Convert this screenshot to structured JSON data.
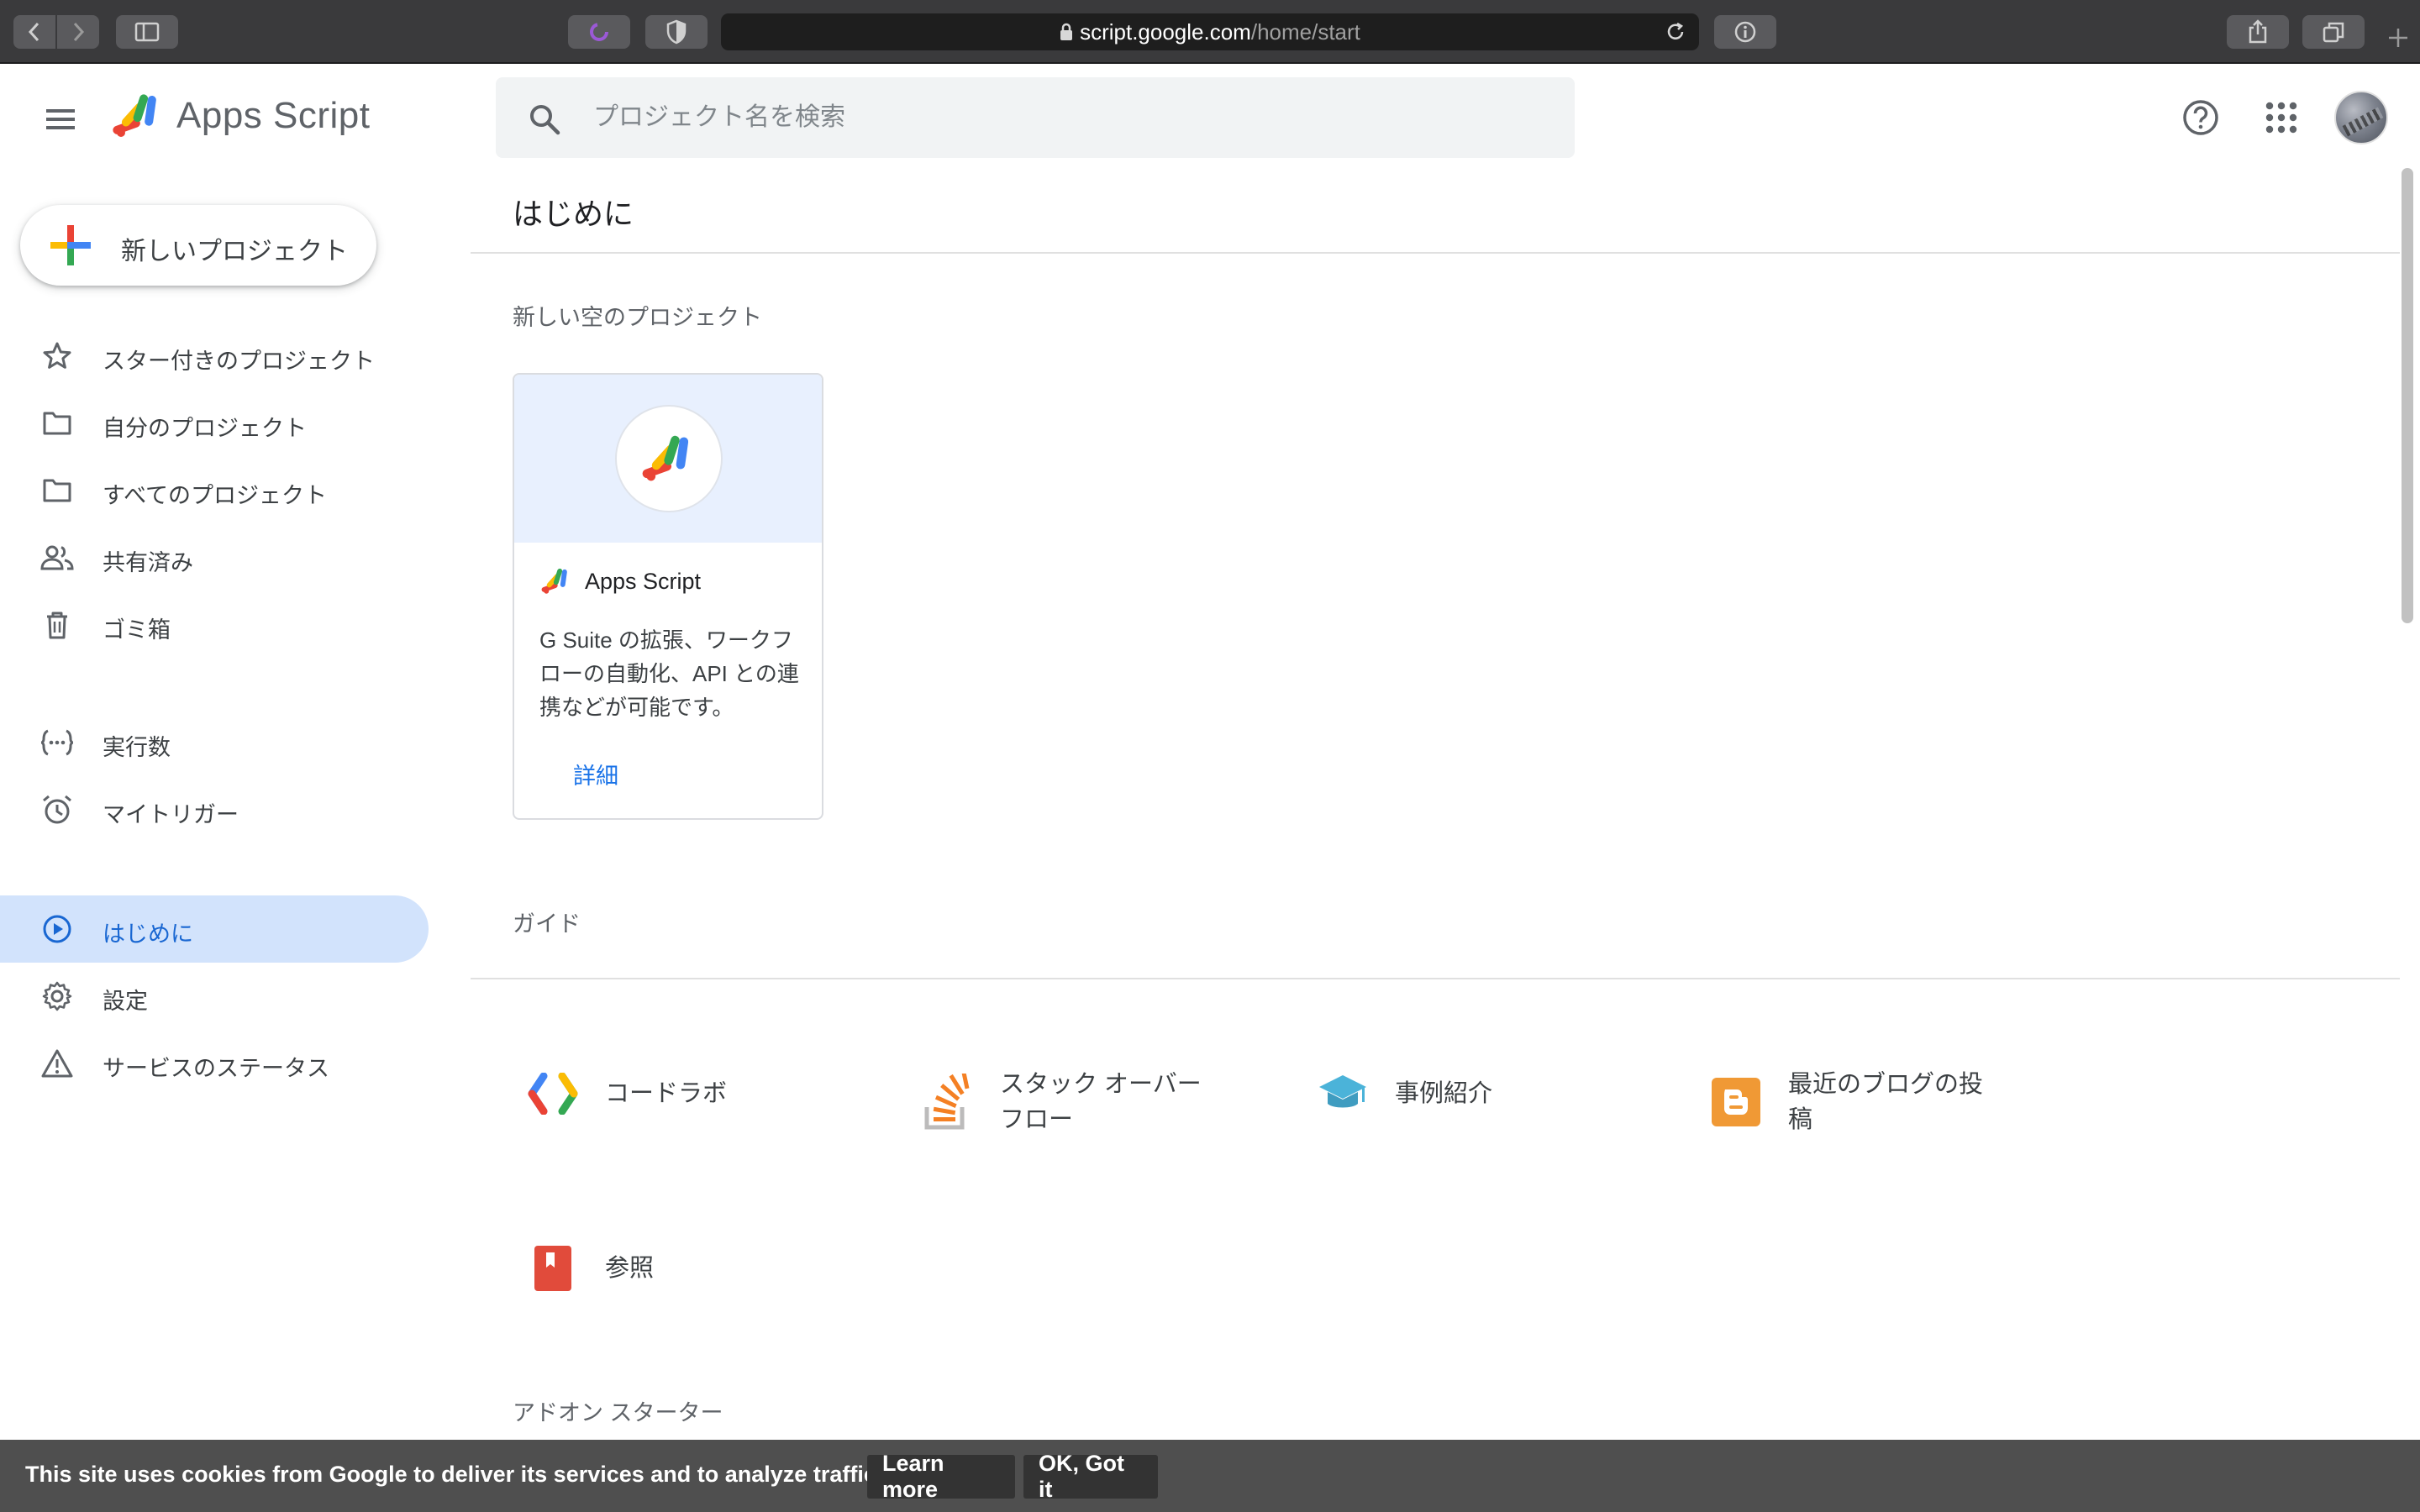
{
  "browser": {
    "url_host": "script.google.com",
    "url_path": "/home/start"
  },
  "header": {
    "app_name": "Apps Script",
    "search_placeholder": "プロジェクト名を検索"
  },
  "sidebar": {
    "new_project_label": "新しいプロジェクト",
    "items": [
      {
        "label": "スター付きのプロジェクト",
        "icon": "star-icon"
      },
      {
        "label": "自分のプロジェクト",
        "icon": "folder-icon"
      },
      {
        "label": "すべてのプロジェクト",
        "icon": "folder-icon"
      },
      {
        "label": "共有済み",
        "icon": "people-icon"
      },
      {
        "label": "ゴミ箱",
        "icon": "trash-icon"
      },
      {
        "label": "実行数",
        "icon": "executions-icon"
      },
      {
        "label": "マイトリガー",
        "icon": "alarm-icon"
      },
      {
        "label": "はじめに",
        "icon": "play-circle-icon",
        "active": true
      },
      {
        "label": "設定",
        "icon": "gear-icon"
      },
      {
        "label": "サービスのステータス",
        "icon": "warning-icon"
      }
    ]
  },
  "main": {
    "page_title": "はじめに",
    "new_blank_section": "新しい空のプロジェクト",
    "card": {
      "brand_name": "Apps Script",
      "description": "G Suite の拡張、ワークフローの自動化、API との連携などが可能です。",
      "link_label": "詳細"
    },
    "guide_section": "ガイド",
    "guides": [
      {
        "label": "コードラボ",
        "icon": "codelabs-icon"
      },
      {
        "label": "スタック オーバーフロー",
        "icon": "stack-overflow-icon"
      },
      {
        "label": "事例紹介",
        "icon": "graduation-cap-icon"
      },
      {
        "label": "最近のブログの投稿",
        "icon": "blogger-icon"
      },
      {
        "label": "参照",
        "icon": "reference-book-icon"
      }
    ],
    "addon_section": "アドオン スターター"
  },
  "cookie_banner": {
    "text": "This site uses cookies from Google to deliver its services and to analyze traffic.",
    "learn_more": "Learn more",
    "ok": "OK, Got it"
  },
  "colors": {
    "accent": "#1a73e8",
    "active_nav_bg": "#d2e3fc",
    "card_hero_bg": "#e8f0fe"
  }
}
